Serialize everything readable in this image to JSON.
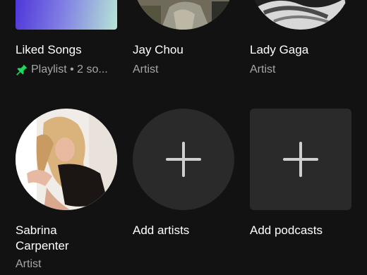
{
  "library": {
    "items": [
      {
        "title": "Liked Songs",
        "subtitle": "Playlist • 2 so...",
        "type": "playlist",
        "pinned": true,
        "pin_color": "#1ed760"
      },
      {
        "title": "Jay Chou",
        "subtitle": "Artist",
        "type": "artist"
      },
      {
        "title": "Lady Gaga",
        "subtitle": "Artist",
        "type": "artist"
      },
      {
        "title": "Sabrina Carpenter",
        "title_line1": "Sabrina",
        "title_line2": "Carpenter",
        "subtitle": "Artist",
        "type": "artist"
      },
      {
        "title": "Add artists",
        "type": "add-action",
        "icon": "plus-icon"
      },
      {
        "title": "Add podcasts",
        "type": "add-action",
        "icon": "plus-icon"
      }
    ]
  },
  "colors": {
    "background": "#121212",
    "add_tile": "#2a2a2a",
    "secondary_text": "#a7a7a7",
    "liked_gradient_start": "#5a3de0",
    "liked_gradient_end": "#b7e4d6"
  }
}
